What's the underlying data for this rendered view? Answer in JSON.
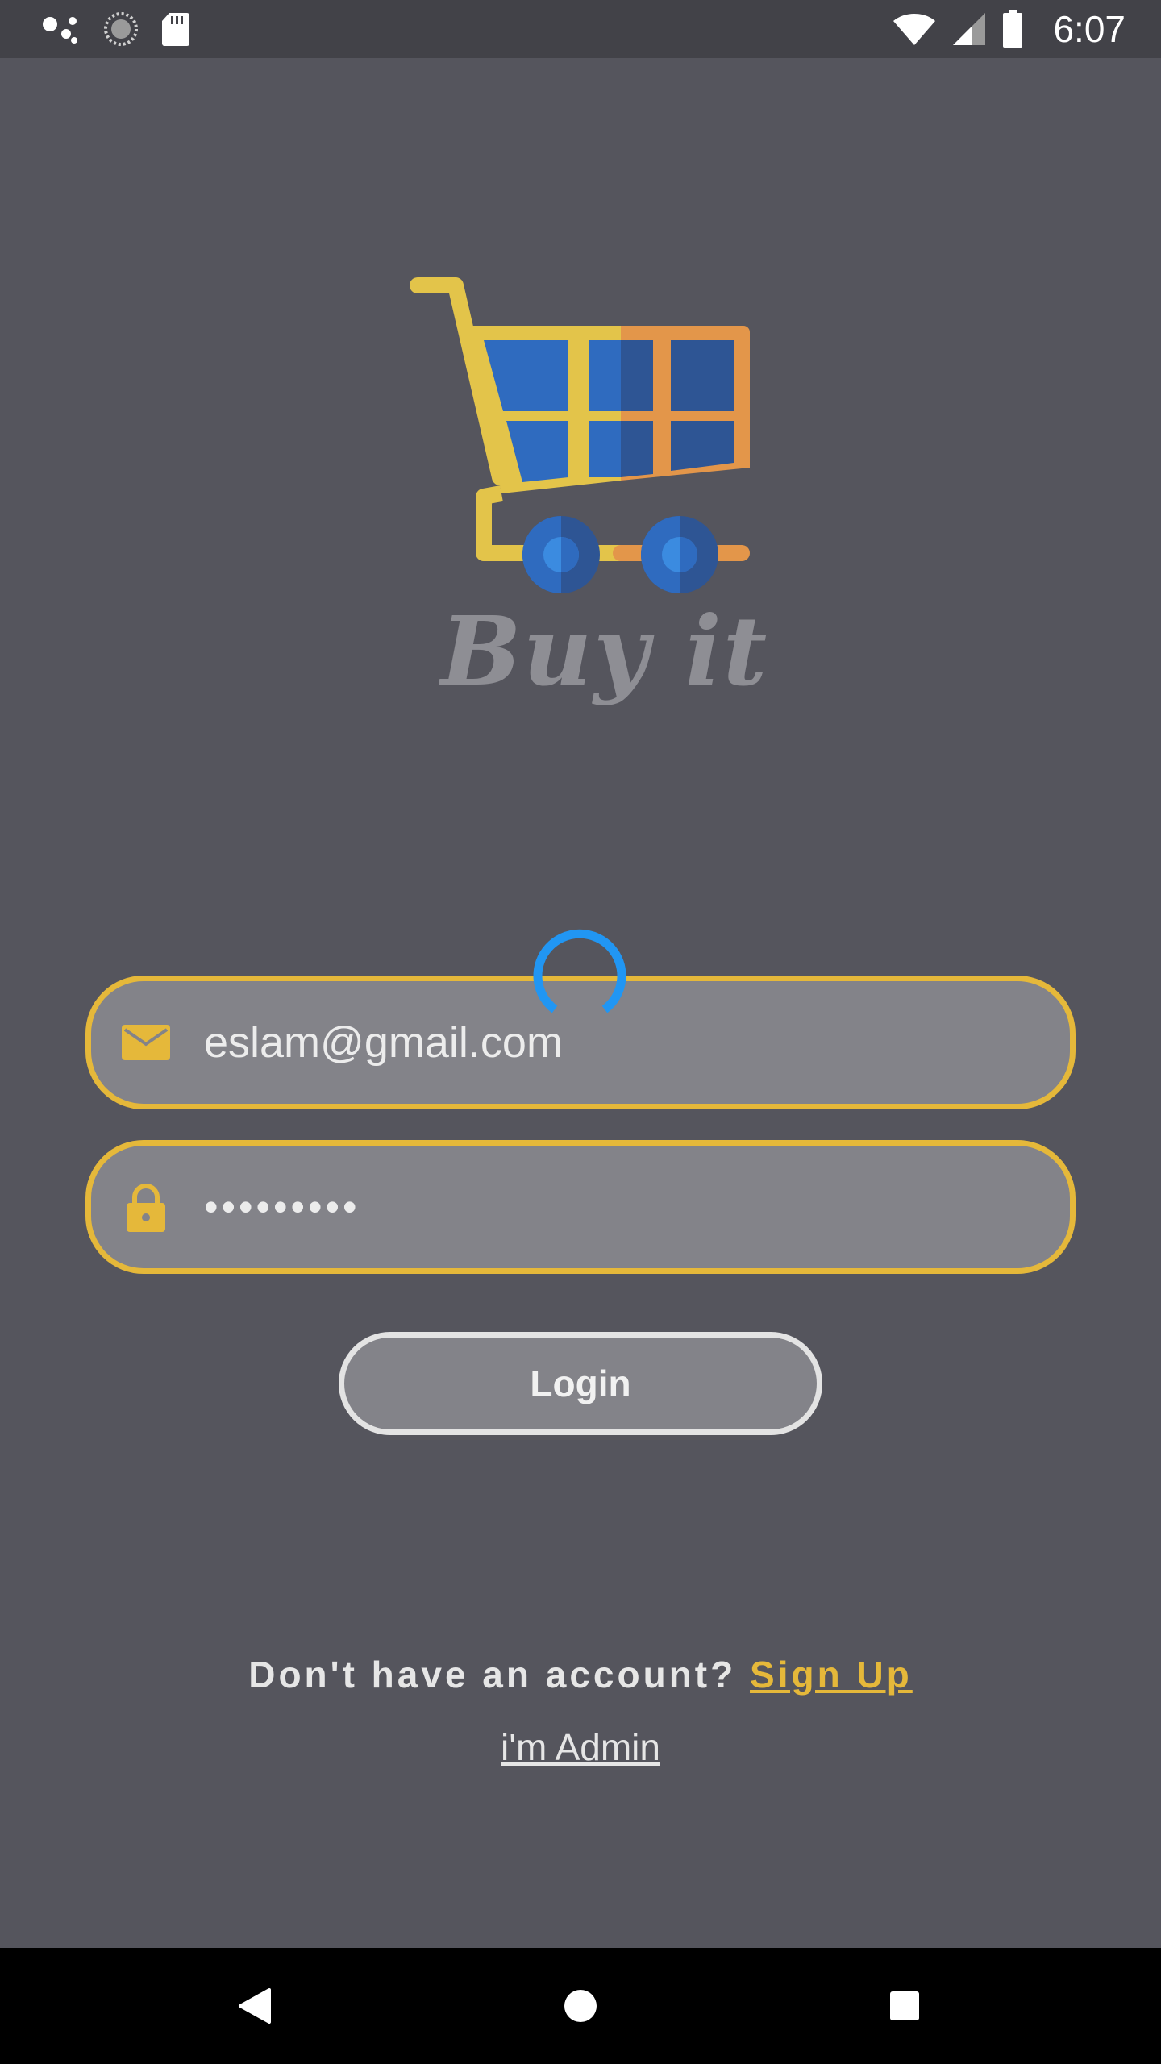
{
  "status_bar": {
    "time": "6:07",
    "left_icons": [
      "assistant-dots-icon",
      "sync-icon",
      "sd-card-icon"
    ],
    "right_icons": [
      "wifi-icon",
      "cell-signal-icon",
      "battery-icon"
    ]
  },
  "brand": {
    "name": "Buy it",
    "logo_icon": "shopping-cart-icon"
  },
  "form": {
    "email_value": "eslam@gmail.com",
    "email_icon": "mail-icon",
    "password_value": "•••••••••",
    "password_icon": "lock-icon",
    "loading": true
  },
  "buttons": {
    "login_label": "Login"
  },
  "footer": {
    "signup_prompt": "Don't have an account? ",
    "signup_link": "Sign Up",
    "admin_link": "i'm Admin"
  },
  "nav_bar": {
    "icons": [
      "back-icon",
      "home-icon",
      "recents-icon"
    ]
  },
  "colors": {
    "background": "#55555d",
    "accent": "#e5b83a",
    "field_fill": "#838389",
    "spinner": "#2196f3"
  }
}
